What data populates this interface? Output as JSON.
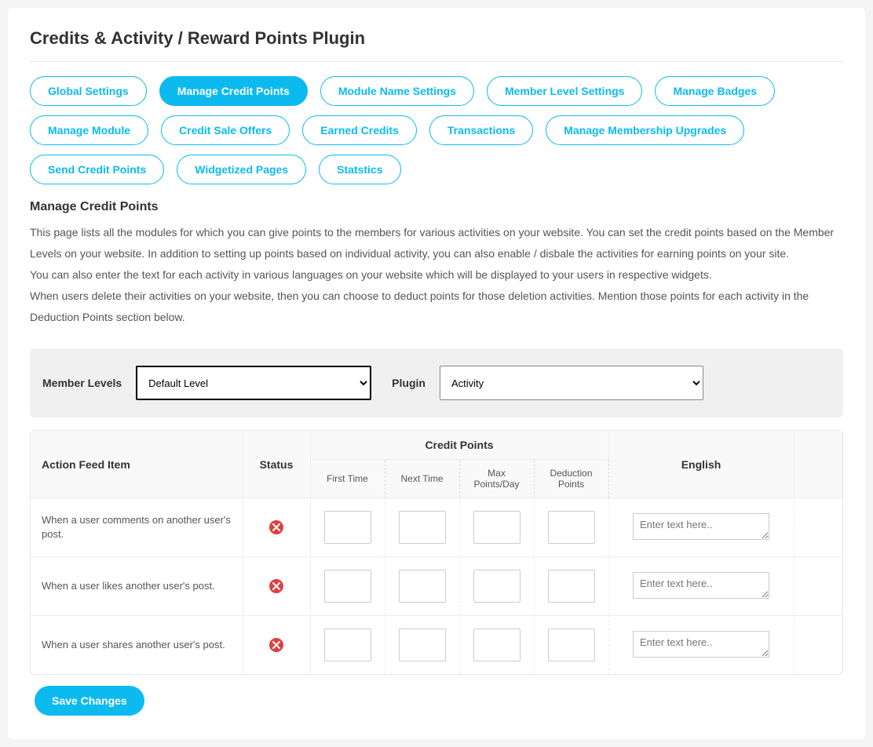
{
  "page_title": "Credits & Activity / Reward Points Plugin",
  "tabs": [
    "Global Settings",
    "Manage Credit Points",
    "Module Name Settings",
    "Member Level Settings",
    "Manage Badges",
    "Manage Module",
    "Credit Sale Offers",
    "Earned Credits",
    "Transactions",
    "Manage Membership Upgrades",
    "Send Credit Points",
    "Widgetized Pages",
    "Statstics"
  ],
  "active_tab_index": 1,
  "section_title": "Manage Credit Points",
  "description": [
    "This page lists all the modules for which you can give points to the members for various activities on your website. You can set the credit points based on the Member Levels on your website. In addition to setting up points based on individual activity, you can also enable / disbale the activities for earning points on your site.",
    "You can also enter the text for each activity in various languages on your website which will be displayed to your users in respective widgets.",
    "When users delete their activities on your website, then you can choose to deduct points for those deletion activities. Mention those points for each activity in the Deduction Points section below."
  ],
  "filters": {
    "member_level_label": "Member Levels",
    "member_level_value": "Default Level",
    "plugin_label": "Plugin",
    "plugin_value": "Activity"
  },
  "table": {
    "head": {
      "action": "Action Feed Item",
      "status": "Status",
      "credit_group": "Credit Points",
      "first_time": "First Time",
      "next_time": "Next Time",
      "max_points": "Max Points/Day",
      "deduction": "Deduction Points",
      "english": "English"
    },
    "rows": [
      {
        "action": "When a user comments on another user's post.",
        "status": "disabled"
      },
      {
        "action": "When a user likes another user's post.",
        "status": "disabled"
      },
      {
        "action": "When a user shares another user's post.",
        "status": "disabled"
      }
    ],
    "input_placeholder": "",
    "textarea_placeholder": "Enter text here.."
  },
  "save_button": "Save Changes",
  "colors": {
    "accent": "#0cbaf0",
    "status_bad": "#e04040"
  }
}
